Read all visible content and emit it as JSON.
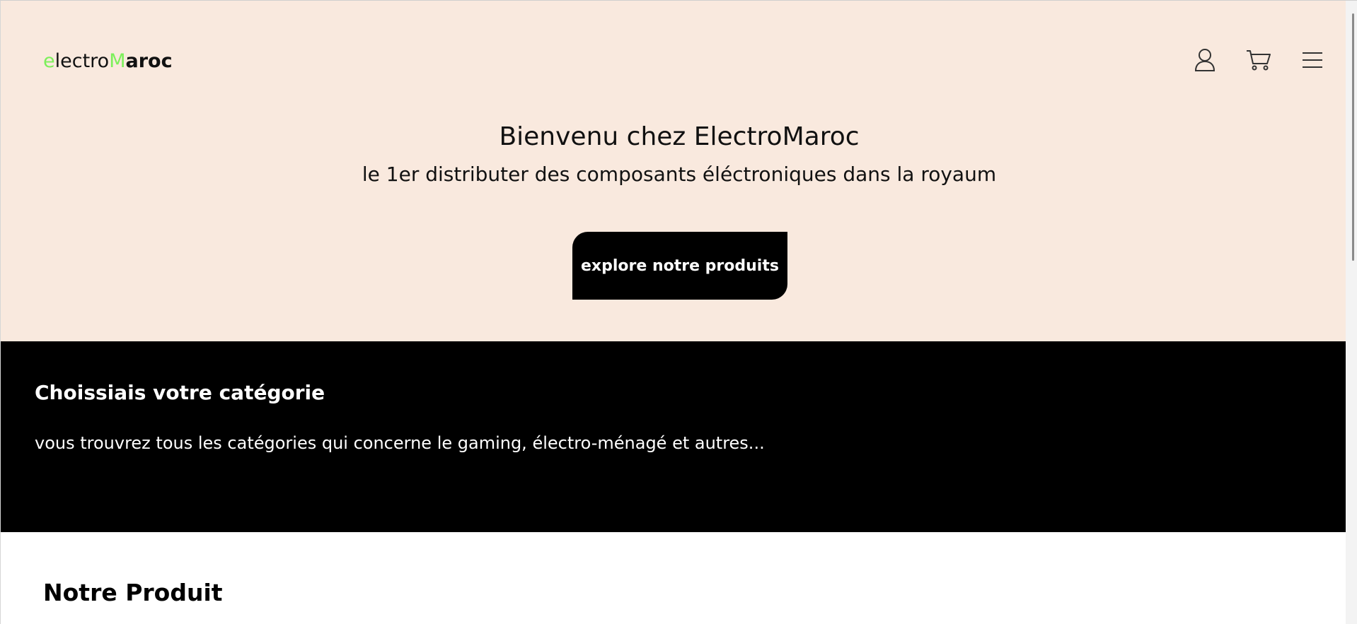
{
  "header": {
    "logo": {
      "part1_accent": "e",
      "part2": "lectro",
      "part3_accent": "M",
      "part4": "aroc"
    },
    "icons": [
      "user-icon",
      "cart-icon",
      "menu-icon"
    ]
  },
  "hero": {
    "title": "Bienvenu chez ElectroMaroc",
    "subtitle": "le 1er distributer des composants éléctroniques dans la royaum",
    "cta_label": "explore notre produits"
  },
  "categories": {
    "title": "Choissiais votre catégorie",
    "description": "vous trouvrez tous les catégories qui concerne le gaming, électro-ménagé et autres..."
  },
  "products": {
    "title": "Notre Produit"
  },
  "colors": {
    "hero_background": "#f9e9de",
    "accent_green": "#7cf05a",
    "band_background": "#000000"
  }
}
